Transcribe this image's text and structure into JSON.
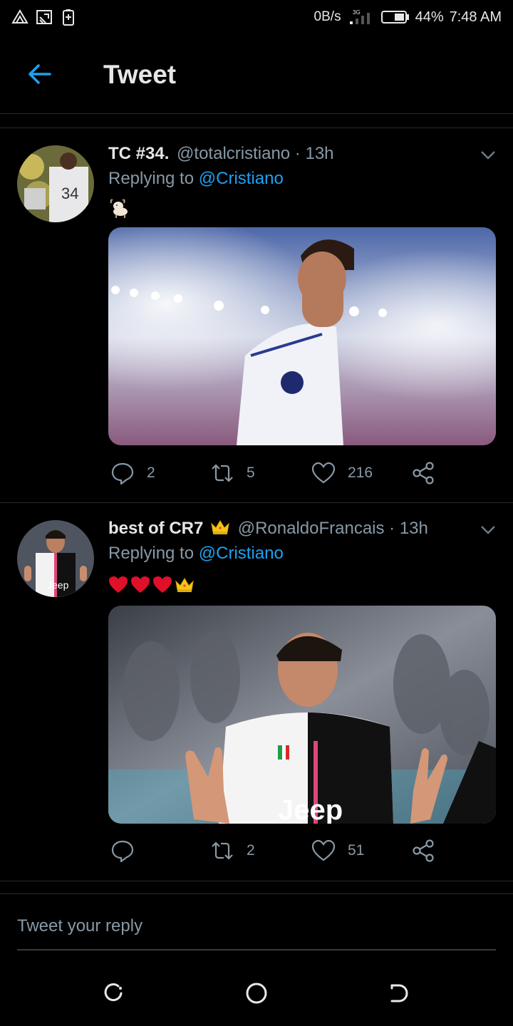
{
  "status_bar": {
    "net_speed": "0B/s",
    "network_type": "3G",
    "battery": "44%",
    "time": "7:48 AM",
    "icons": [
      "drive-icon",
      "cast-icon",
      "battery-saver-icon",
      "signal-icon",
      "battery-icon"
    ]
  },
  "header": {
    "title": "Tweet",
    "back_icon": "arrow-left-icon",
    "accent_color": "#1da1f2"
  },
  "tweets": [
    {
      "name": "TC #34.",
      "handle": "@totalcristiano · 13h",
      "replying_prefix": "Replying to",
      "replying_to": "@Cristiano",
      "emojis": [
        "goat-emoji"
      ],
      "media_description": "photo",
      "actions": {
        "replies": "2",
        "retweets": "5",
        "likes": "216"
      }
    },
    {
      "name": "best of CR7",
      "name_badge": "crown-emoji",
      "handle": "@RonaldoFrancais · 13h",
      "replying_prefix": "Replying to",
      "replying_to": "@Cristiano",
      "emojis": [
        "heart-emoji",
        "heart-emoji",
        "heart-emoji",
        "crown-emoji"
      ],
      "media_description": "photo",
      "media_text": "Jeep",
      "actions": {
        "replies": "",
        "retweets": "2",
        "likes": "51"
      }
    }
  ],
  "reply": {
    "placeholder": "Tweet your reply"
  },
  "nav": {
    "icons": [
      "recent-apps-icon",
      "home-icon",
      "back-icon"
    ]
  }
}
